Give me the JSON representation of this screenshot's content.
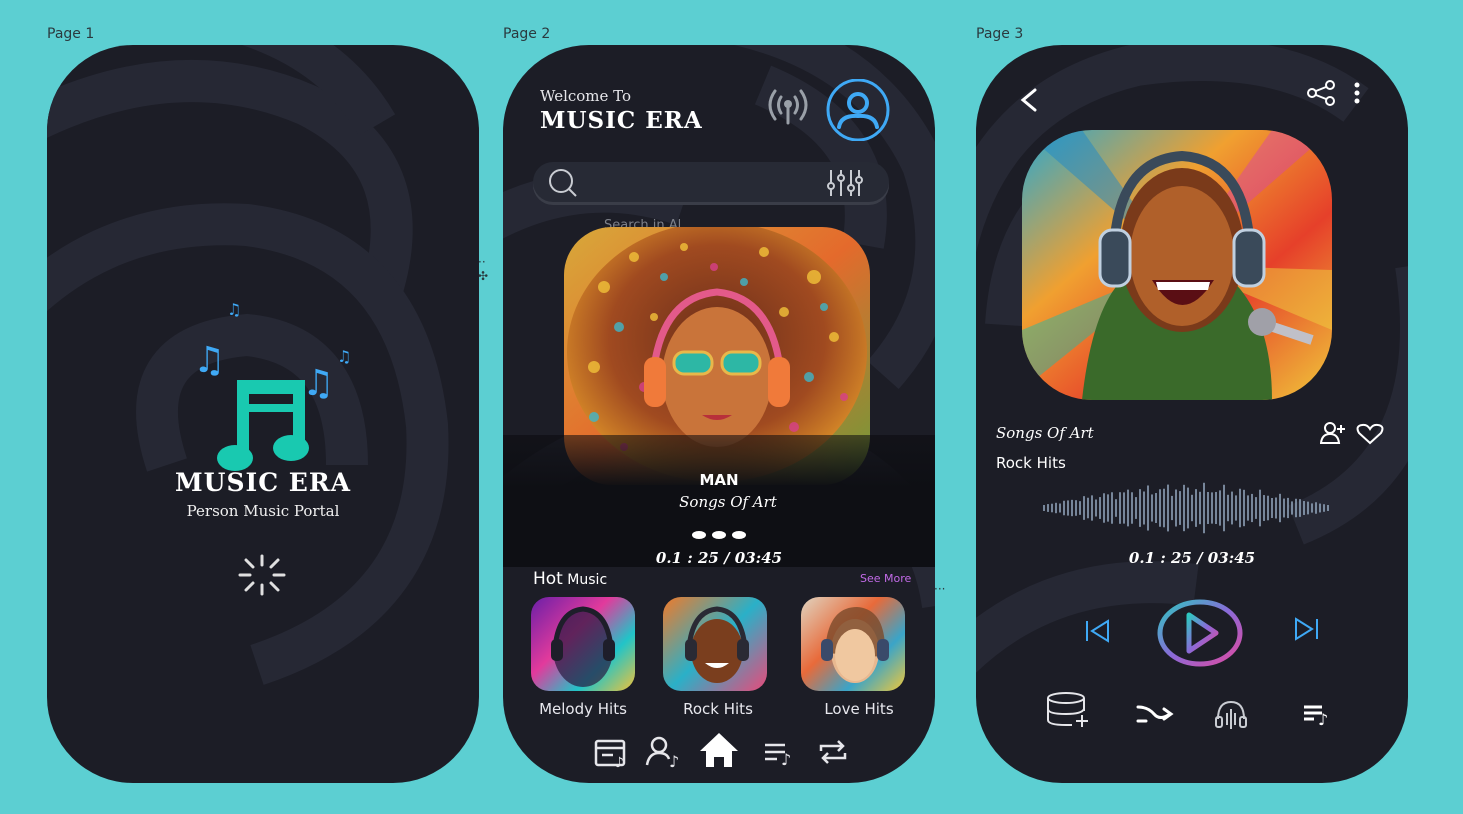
{
  "labels": {
    "page1": "Page 1",
    "page2": "Page 2",
    "page3": "Page 3"
  },
  "splash": {
    "app_name": "MUSIC ERA",
    "tagline": "Person Music Portal"
  },
  "home": {
    "welcome": "Welcome To",
    "app_name": "MUSIC ERA",
    "search_placeholder": "Search in Al...",
    "featured": {
      "title": "MAN",
      "subtitle": "Songs Of Art",
      "time": "0.1 : 25  / 03:45"
    },
    "hot_music": {
      "heading_bold": "Hot",
      "heading_rest": " Music",
      "see_more": "See More",
      "items": [
        {
          "label": "Melody Hits"
        },
        {
          "label": "Rock Hits"
        },
        {
          "label": "Love Hits"
        }
      ]
    }
  },
  "player": {
    "song_title": "Songs Of Art",
    "album": "Rock Hits",
    "time": "0.1 : 25  / 03:45"
  },
  "colors": {
    "background": "#5ccfd2",
    "phone": "#1c1d26",
    "accent_teal": "#19c9b0",
    "accent_blue": "#3fa9f5",
    "accent_pink": "#d94a9e",
    "see_more": "#c36be8"
  },
  "icons": {
    "radio": "broadcast-icon",
    "profile": "user-circle-icon",
    "search": "search-icon",
    "filter": "sliders-icon",
    "back": "chevron-left-icon",
    "share": "share-icon",
    "more": "more-vertical-icon",
    "add_user": "user-plus-icon",
    "like": "heart-icon",
    "prev": "skip-previous-icon",
    "play": "play-icon",
    "next": "skip-next-icon",
    "add_db": "database-plus-icon",
    "shuffle": "shuffle-icon",
    "audio": "headphones-wave-icon",
    "queue": "playlist-icon"
  }
}
